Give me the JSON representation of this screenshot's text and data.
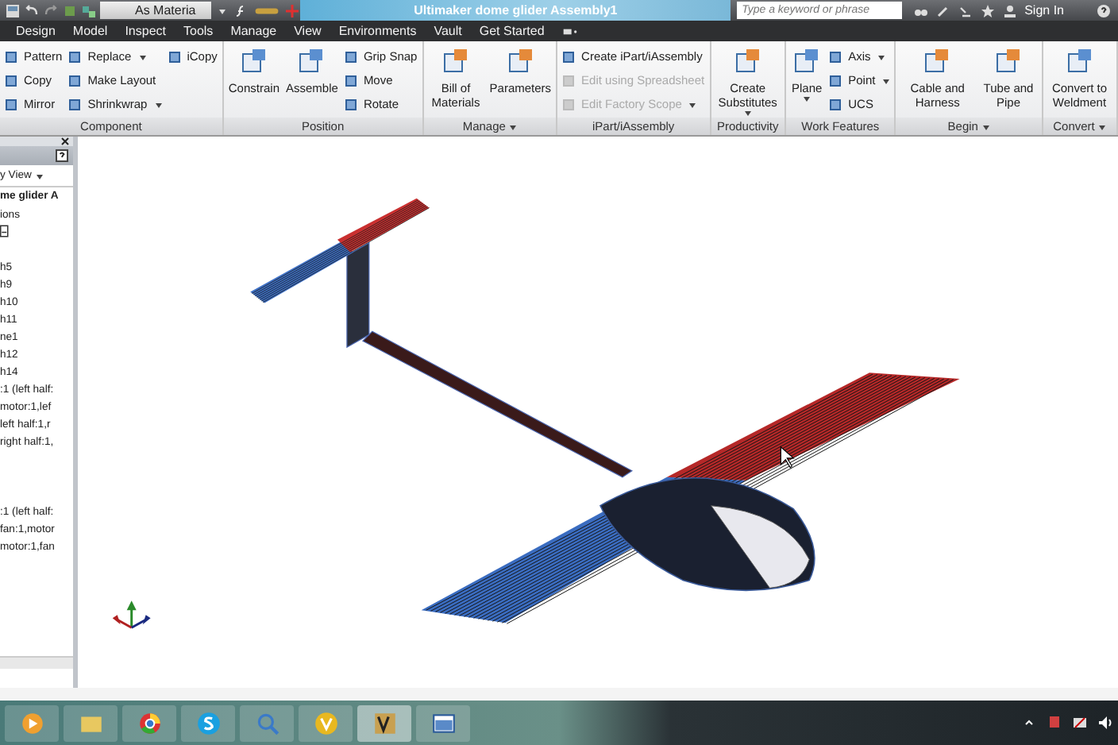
{
  "quick_access": {
    "style_dropdown": "As Materia"
  },
  "window": {
    "title": "Ultimaker dome glider Assembly1"
  },
  "search": {
    "placeholder": "Type a keyword or phrase"
  },
  "account": {
    "label": "Sign In"
  },
  "tabs": [
    {
      "label": "Design"
    },
    {
      "label": "Model"
    },
    {
      "label": "Inspect"
    },
    {
      "label": "Tools"
    },
    {
      "label": "Manage"
    },
    {
      "label": "View"
    },
    {
      "label": "Environments"
    },
    {
      "label": "Vault"
    },
    {
      "label": "Get Started"
    }
  ],
  "ribbon": {
    "groups": [
      {
        "label": "Component",
        "dropdown": false,
        "columns": [
          {
            "kind": "stack",
            "tools": [
              {
                "label": "Pattern",
                "dropdown": false,
                "disabled": false
              },
              {
                "label": "Copy",
                "dropdown": false,
                "disabled": false
              },
              {
                "label": "Mirror",
                "dropdown": false,
                "disabled": false
              }
            ]
          },
          {
            "kind": "stack",
            "tools": [
              {
                "label": "Replace",
                "dropdown": true,
                "disabled": false
              },
              {
                "label": "Make Layout",
                "dropdown": false,
                "disabled": false
              },
              {
                "label": "Shrinkwrap",
                "dropdown": true,
                "disabled": false
              }
            ]
          },
          {
            "kind": "stack",
            "tools": [
              {
                "label": "iCopy",
                "dropdown": false,
                "disabled": false
              }
            ]
          }
        ]
      },
      {
        "label": "Position",
        "dropdown": false,
        "columns": [
          {
            "kind": "large",
            "label": "Constrain",
            "dropdown": false
          },
          {
            "kind": "large",
            "label": "Assemble",
            "dropdown": false
          },
          {
            "kind": "stack",
            "tools": [
              {
                "label": "Grip Snap",
                "dropdown": false,
                "disabled": false
              },
              {
                "label": "Move",
                "dropdown": false,
                "disabled": false
              },
              {
                "label": "Rotate",
                "dropdown": false,
                "disabled": false
              }
            ]
          }
        ]
      },
      {
        "label": "Manage",
        "dropdown": true,
        "columns": [
          {
            "kind": "large",
            "label": "Bill of Materials",
            "dropdown": false
          },
          {
            "kind": "large",
            "label": "Parameters",
            "dropdown": false
          }
        ]
      },
      {
        "label": "iPart/iAssembly",
        "dropdown": false,
        "columns": [
          {
            "kind": "stack",
            "tools": [
              {
                "label": "Create iPart/iAssembly",
                "dropdown": false,
                "disabled": false
              },
              {
                "label": "Edit using Spreadsheet",
                "dropdown": false,
                "disabled": true
              },
              {
                "label": "Edit Factory Scope",
                "dropdown": true,
                "disabled": true
              }
            ]
          }
        ]
      },
      {
        "label": "Productivity",
        "dropdown": false,
        "columns": [
          {
            "kind": "large",
            "label": "Create Substitutes",
            "dropdown": true
          }
        ]
      },
      {
        "label": "Work Features",
        "dropdown": false,
        "columns": [
          {
            "kind": "large",
            "label": "Plane",
            "dropdown": true
          },
          {
            "kind": "stack",
            "tools": [
              {
                "label": "Axis",
                "dropdown": true,
                "disabled": false
              },
              {
                "label": "Point",
                "dropdown": true,
                "disabled": false
              },
              {
                "label": "UCS",
                "dropdown": false,
                "disabled": false
              }
            ]
          }
        ]
      },
      {
        "label": "Begin",
        "dropdown": true,
        "columns": [
          {
            "kind": "large",
            "label": "Cable and Harness",
            "dropdown": false
          },
          {
            "kind": "large",
            "label": "Tube and Pipe",
            "dropdown": false
          }
        ]
      },
      {
        "label": "Convert",
        "dropdown": true,
        "columns": [
          {
            "kind": "large",
            "label": "Convert to Weldment",
            "dropdown": false
          }
        ]
      }
    ]
  },
  "browser": {
    "view_dropdown": "y View",
    "root": "me glider A",
    "items": [
      {
        "kind": "text",
        "label": "ions"
      },
      {
        "kind": "box"
      },
      {
        "kind": "gap"
      },
      {
        "kind": "text",
        "label": "h5"
      },
      {
        "kind": "text",
        "label": "h9"
      },
      {
        "kind": "text",
        "label": "h10"
      },
      {
        "kind": "text",
        "label": "h11"
      },
      {
        "kind": "text",
        "label": "ne1"
      },
      {
        "kind": "text",
        "label": "h12"
      },
      {
        "kind": "text",
        "label": "h14"
      },
      {
        "kind": "text",
        "label": ":1 (left half:"
      },
      {
        "kind": "text",
        "label": "motor:1,lef"
      },
      {
        "kind": "text",
        "label": "left half:1,r"
      },
      {
        "kind": "text",
        "label": "right half:1,"
      },
      {
        "kind": "gap"
      },
      {
        "kind": "gap"
      },
      {
        "kind": "gap"
      },
      {
        "kind": "text",
        "label": ":1 (left half:"
      },
      {
        "kind": "text",
        "label": "fan:1,motor"
      },
      {
        "kind": "text",
        "label": "motor:1,fan"
      }
    ]
  }
}
